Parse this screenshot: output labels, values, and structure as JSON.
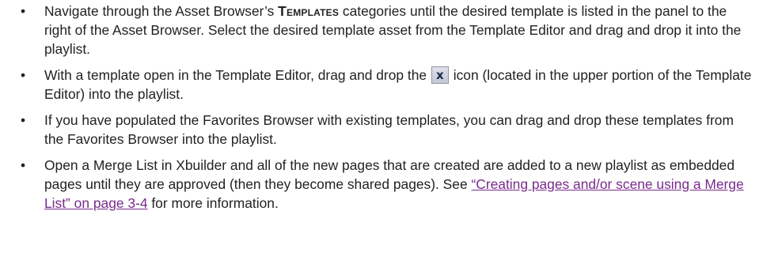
{
  "bullets": [
    {
      "marker": "•",
      "before": "Navigate through the Asset Browser’s ",
      "emphasis": "Templates",
      "after": " categories until the desired template is listed in the panel to the right of the Asset Browser. Select the desired template asset from the Template Editor and drag and drop it into the playlist."
    },
    {
      "marker": "•",
      "before": "With a template open in the Template Editor, drag and drop the ",
      "icon": {
        "name": "template-x-icon",
        "glyph": "x"
      },
      "after": " icon (located in the upper portion of the Template Editor) into the playlist."
    },
    {
      "marker": "•",
      "text": "If you have populated the Favorites Browser with existing templates, you can drag and drop these templates from the Favorites Browser into the playlist."
    },
    {
      "marker": "•",
      "before": "Open a Merge List in Xbuilder and all of the new pages that are created are added to a new playlist as embedded pages until they are approved (then they become shared pages). See ",
      "link_text": "“Creating pages and/or scene using a Merge List” on page 3-4",
      "after": " for more information."
    }
  ],
  "colors": {
    "text": "#222222",
    "link": "#7a2a8c"
  }
}
